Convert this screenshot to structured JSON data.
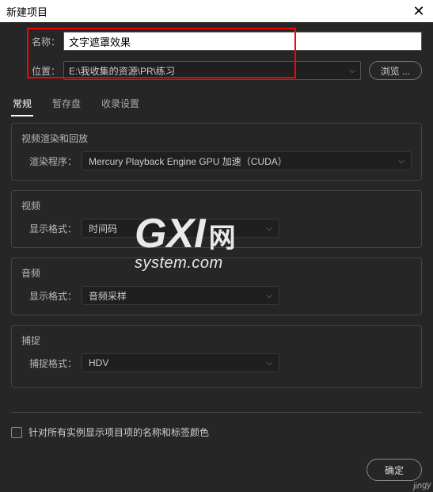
{
  "window": {
    "title": "新建项目"
  },
  "fields": {
    "name_label": "名称：",
    "name_value": "文字遮罩效果",
    "location_label": "位置：",
    "location_value": "E:\\我收集的资源\\PR\\练习",
    "browse_label": "浏览 ..."
  },
  "tabs": {
    "general": "常规",
    "scratch": "暂存盘",
    "ingest": "收录设置"
  },
  "groups": {
    "video_render": {
      "title": "视频渲染和回放",
      "renderer_label": "渲染程序：",
      "renderer_value": "Mercury Playback Engine GPU 加速（CUDA）"
    },
    "video": {
      "title": "视频",
      "format_label": "显示格式：",
      "format_value": "时间码"
    },
    "audio": {
      "title": "音频",
      "format_label": "显示格式：",
      "format_value": "音频采样"
    },
    "capture": {
      "title": "捕捉",
      "format_label": "捕捉格式：",
      "format_value": "HDV"
    }
  },
  "checkbox": {
    "label": "针对所有实例显示项目项的名称和标签颜色"
  },
  "footer": {
    "ok_label": "确定"
  },
  "watermark": {
    "brand": "GXI",
    "net": "网",
    "sys": "system.com",
    "corner": "jingy"
  }
}
